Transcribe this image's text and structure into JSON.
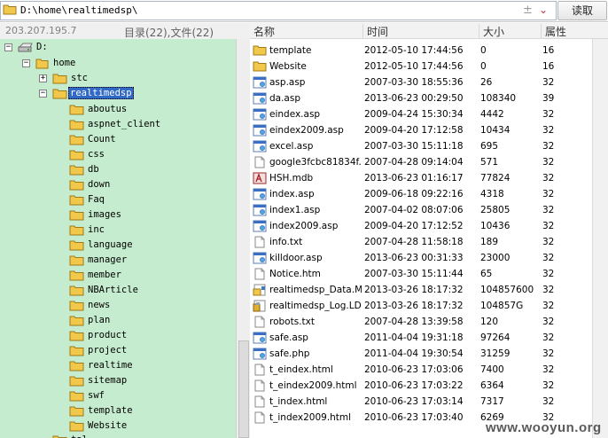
{
  "address_bar": {
    "path": "D:\\home\\realtimedsp\\",
    "plus_symbol": "±",
    "dropdown_symbol": "⌄",
    "read_button": "读取"
  },
  "info_bar": {
    "ip": "203.207.195.7",
    "counts": "目录(22),文件(22)"
  },
  "columns": {
    "name": "名称",
    "time": "时间",
    "size": "大小",
    "attr": "属性"
  },
  "tree": {
    "drive": "D:",
    "home": "home",
    "stc": "stc",
    "selected": "realtimedsp",
    "children": [
      "aboutus",
      "aspnet_client",
      "Count",
      "css",
      "db",
      "down",
      "Faq",
      "images",
      "inc",
      "language",
      "manager",
      "member",
      "NBArticle",
      "news",
      "plan",
      "product",
      "project",
      "realtime",
      "sitemap",
      "swf",
      "template",
      "Website"
    ],
    "partial": "tal"
  },
  "files": [
    {
      "name": "template",
      "time": "2012-05-10 17:44:56",
      "size": "0",
      "attr": "16",
      "icon": "folder-icon"
    },
    {
      "name": "Website",
      "time": "2012-05-10 17:44:56",
      "size": "0",
      "attr": "16",
      "icon": "folder-icon"
    },
    {
      "name": "asp.asp",
      "time": "2007-03-30 18:55:36",
      "size": "26",
      "attr": "32",
      "icon": "asp-file-icon"
    },
    {
      "name": "da.asp",
      "time": "2013-06-23 00:29:50",
      "size": "108340",
      "attr": "39",
      "icon": "asp-file-icon"
    },
    {
      "name": "eindex.asp",
      "time": "2009-04-24 15:30:34",
      "size": "4442",
      "attr": "32",
      "icon": "asp-file-icon"
    },
    {
      "name": "eindex2009.asp",
      "time": "2009-04-20 17:12:58",
      "size": "10434",
      "attr": "32",
      "icon": "asp-file-icon"
    },
    {
      "name": "excel.asp",
      "time": "2007-03-30 15:11:18",
      "size": "695",
      "attr": "32",
      "icon": "asp-file-icon"
    },
    {
      "name": "google3fcbc81834f...",
      "time": "2007-04-28 09:14:04",
      "size": "571",
      "attr": "32",
      "icon": "file-icon"
    },
    {
      "name": "HSH.mdb",
      "time": "2013-06-23 01:16:17",
      "size": "77824",
      "attr": "32",
      "icon": "access-db-icon"
    },
    {
      "name": "index.asp",
      "time": "2009-06-18 09:22:16",
      "size": "4318",
      "attr": "32",
      "icon": "asp-file-icon"
    },
    {
      "name": "index1.asp",
      "time": "2007-04-02 08:07:06",
      "size": "25805",
      "attr": "32",
      "icon": "asp-file-icon"
    },
    {
      "name": "index2009.asp",
      "time": "2009-04-20 17:12:52",
      "size": "10436",
      "attr": "32",
      "icon": "asp-file-icon"
    },
    {
      "name": "info.txt",
      "time": "2007-04-28 11:58:18",
      "size": "189",
      "attr": "32",
      "icon": "file-icon"
    },
    {
      "name": "killdoor.asp",
      "time": "2013-06-23 00:31:33",
      "size": "23000",
      "attr": "32",
      "icon": "asp-file-icon"
    },
    {
      "name": "Notice.htm",
      "time": "2007-03-30 15:11:44",
      "size": "65",
      "attr": "32",
      "icon": "file-icon"
    },
    {
      "name": "realtimedsp_Data.M...",
      "time": "2013-03-26 18:17:32",
      "size": "104857600",
      "attr": "32",
      "icon": "sql-data-icon"
    },
    {
      "name": "realtimedsp_Log.LDF",
      "time": "2013-03-26 18:17:32",
      "size": "104857G",
      "attr": "32",
      "icon": "sql-log-icon"
    },
    {
      "name": "robots.txt",
      "time": "2007-04-28 13:39:58",
      "size": "120",
      "attr": "32",
      "icon": "file-icon"
    },
    {
      "name": "safe.asp",
      "time": "2011-04-04 19:31:18",
      "size": "97264",
      "attr": "32",
      "icon": "asp-file-icon"
    },
    {
      "name": "safe.php",
      "time": "2011-04-04 19:30:54",
      "size": "31259",
      "attr": "32",
      "icon": "asp-file-icon"
    },
    {
      "name": "t_eindex.html",
      "time": "2010-06-23 17:03:06",
      "size": "7400",
      "attr": "32",
      "icon": "file-icon"
    },
    {
      "name": "t_eindex2009.html",
      "time": "2010-06-23 17:03:22",
      "size": "6364",
      "attr": "32",
      "icon": "file-icon"
    },
    {
      "name": "t_index.html",
      "time": "2010-06-23 17:03:14",
      "size": "7317",
      "attr": "32",
      "icon": "file-icon"
    },
    {
      "name": "t_index2009.html",
      "time": "2010-06-23 17:03:40",
      "size": "6269",
      "attr": "32",
      "icon": "file-icon"
    }
  ],
  "watermark": "www.wooyun.org",
  "colors": {
    "tree_bg": "#c5ecce",
    "selection": "#3169c6",
    "folder": "#f2c84b"
  }
}
